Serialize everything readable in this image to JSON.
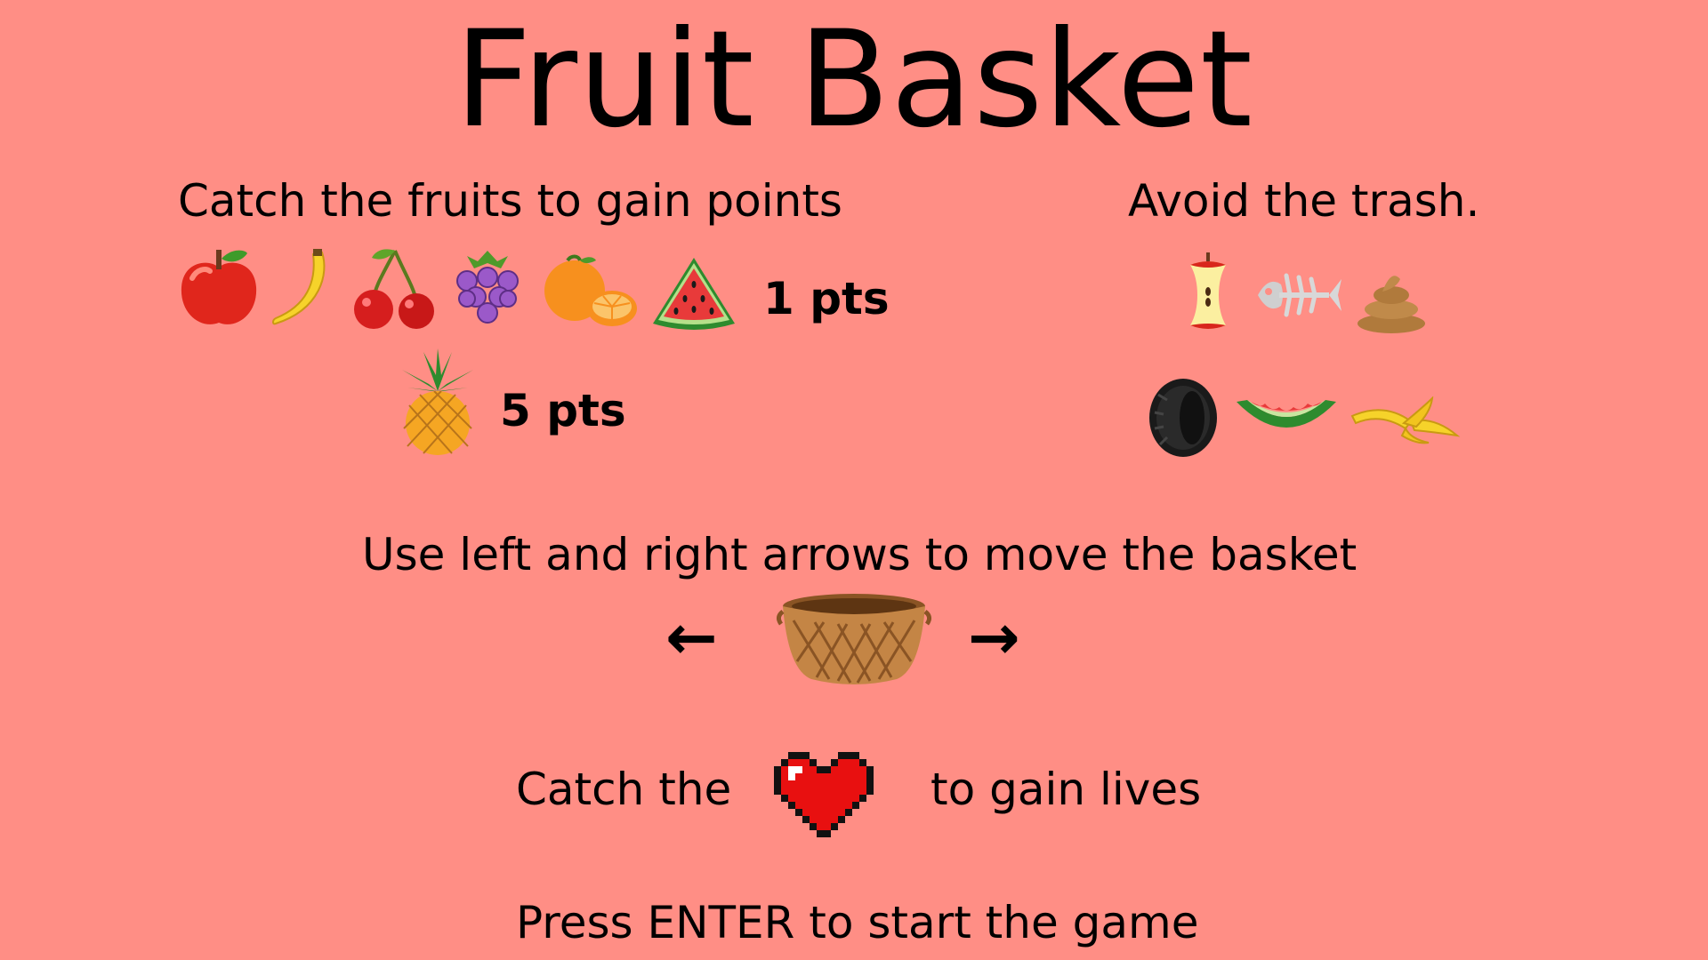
{
  "title": "Fruit Basket",
  "fruits": {
    "heading": "Catch the fruits to gain points",
    "items": [
      "apple-icon",
      "banana-icon",
      "cherry-icon",
      "grape-icon",
      "orange-icon",
      "watermelon-icon"
    ],
    "points_label": "1 pts",
    "bonus_item": "pineapple-icon",
    "bonus_points_label": "5 pts"
  },
  "trash": {
    "heading": "Avoid the trash.",
    "row1": [
      "apple-core-icon",
      "fish-bone-icon",
      "poop-icon"
    ],
    "row2": [
      "tire-icon",
      "watermelon-rind-icon",
      "banana-peel-icon"
    ]
  },
  "controls": {
    "instruction": "Use left and right arrows to move the basket",
    "left_arrow": "←",
    "right_arrow": "→",
    "basket_icon": "basket-icon"
  },
  "lives": {
    "prefix": "Catch the",
    "suffix": "to gain lives",
    "icon": "heart-icon"
  },
  "start_prompt": "Press ENTER to start the game",
  "colors": {
    "background": "#FF8E85",
    "text": "#000000"
  }
}
